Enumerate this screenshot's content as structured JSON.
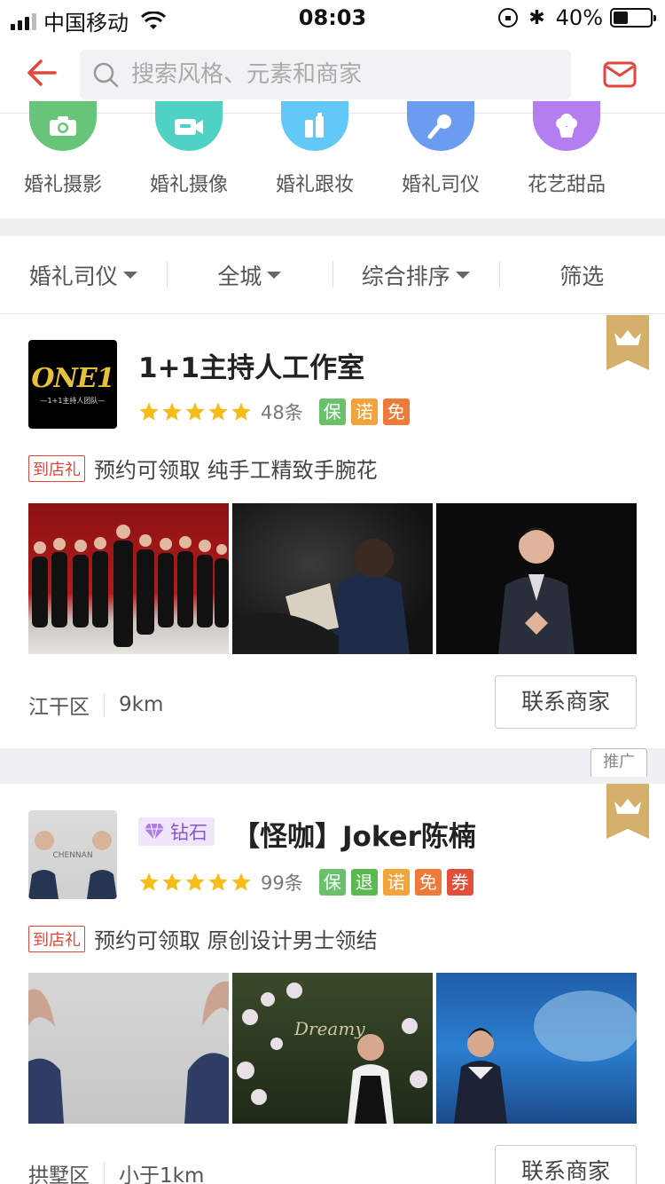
{
  "status_bar": {
    "carrier": "中国移动",
    "time": "08:03",
    "battery": "40%",
    "battery_level": 0.4
  },
  "search": {
    "placeholder": "搜索风格、元素和商家"
  },
  "categories": [
    {
      "label": "婚礼摄影",
      "icon": "camera-icon",
      "color": "#67c57a"
    },
    {
      "label": "婚礼摄像",
      "icon": "video-camera-icon",
      "color": "#4fd2c3"
    },
    {
      "label": "婚礼跟妆",
      "icon": "makeup-icon",
      "color": "#62c8f5"
    },
    {
      "label": "婚礼司仪",
      "icon": "microphone-icon",
      "color": "#6c9cf2"
    },
    {
      "label": "花艺甜品",
      "icon": "cupcake-icon",
      "color": "#b47ef0"
    }
  ],
  "filters": [
    {
      "label": "婚礼司仪",
      "dropdown": true
    },
    {
      "label": "全城",
      "dropdown": true
    },
    {
      "label": "综合排序",
      "dropdown": true
    },
    {
      "label": "筛选",
      "dropdown": false
    }
  ],
  "merchants": [
    {
      "name": "1+1主持人工作室",
      "logo_text": "ONE1",
      "logo_subtext": "—1+1主持人团队—",
      "rating": 5,
      "review_count": "48条",
      "badges": [
        {
          "text": "保",
          "color": "#6bc06b"
        },
        {
          "text": "诺",
          "color": "#f2a43a"
        },
        {
          "text": "免",
          "color": "#ee7a3a"
        }
      ],
      "gift_tag": "到店礼",
      "gift_text": "预约可领取 纯手工精致手腕花",
      "district": "江干区",
      "distance": "9km",
      "contact_label": "联系商家"
    },
    {
      "name": "【怪咖】Joker陈楠",
      "tier": "钻石",
      "logo_text": "CHENNAN",
      "promo_label": "推广",
      "rating": 5,
      "review_count": "99条",
      "badges": [
        {
          "text": "保",
          "color": "#6bc06b"
        },
        {
          "text": "退",
          "color": "#5ab950"
        },
        {
          "text": "诺",
          "color": "#f2a43a"
        },
        {
          "text": "免",
          "color": "#ee7a3a"
        },
        {
          "text": "券",
          "color": "#e2503a"
        }
      ],
      "gift_tag": "到店礼",
      "gift_text": "预约可领取 原创设计男士领结",
      "district": "拱墅区",
      "distance": "小于1km",
      "contact_label": "联系商家"
    }
  ],
  "colors": {
    "accent_red": "#e2453b",
    "star": "#f6bd18",
    "crown_gold": "#d4b06a",
    "diamond_purple": "#8a57c9"
  }
}
